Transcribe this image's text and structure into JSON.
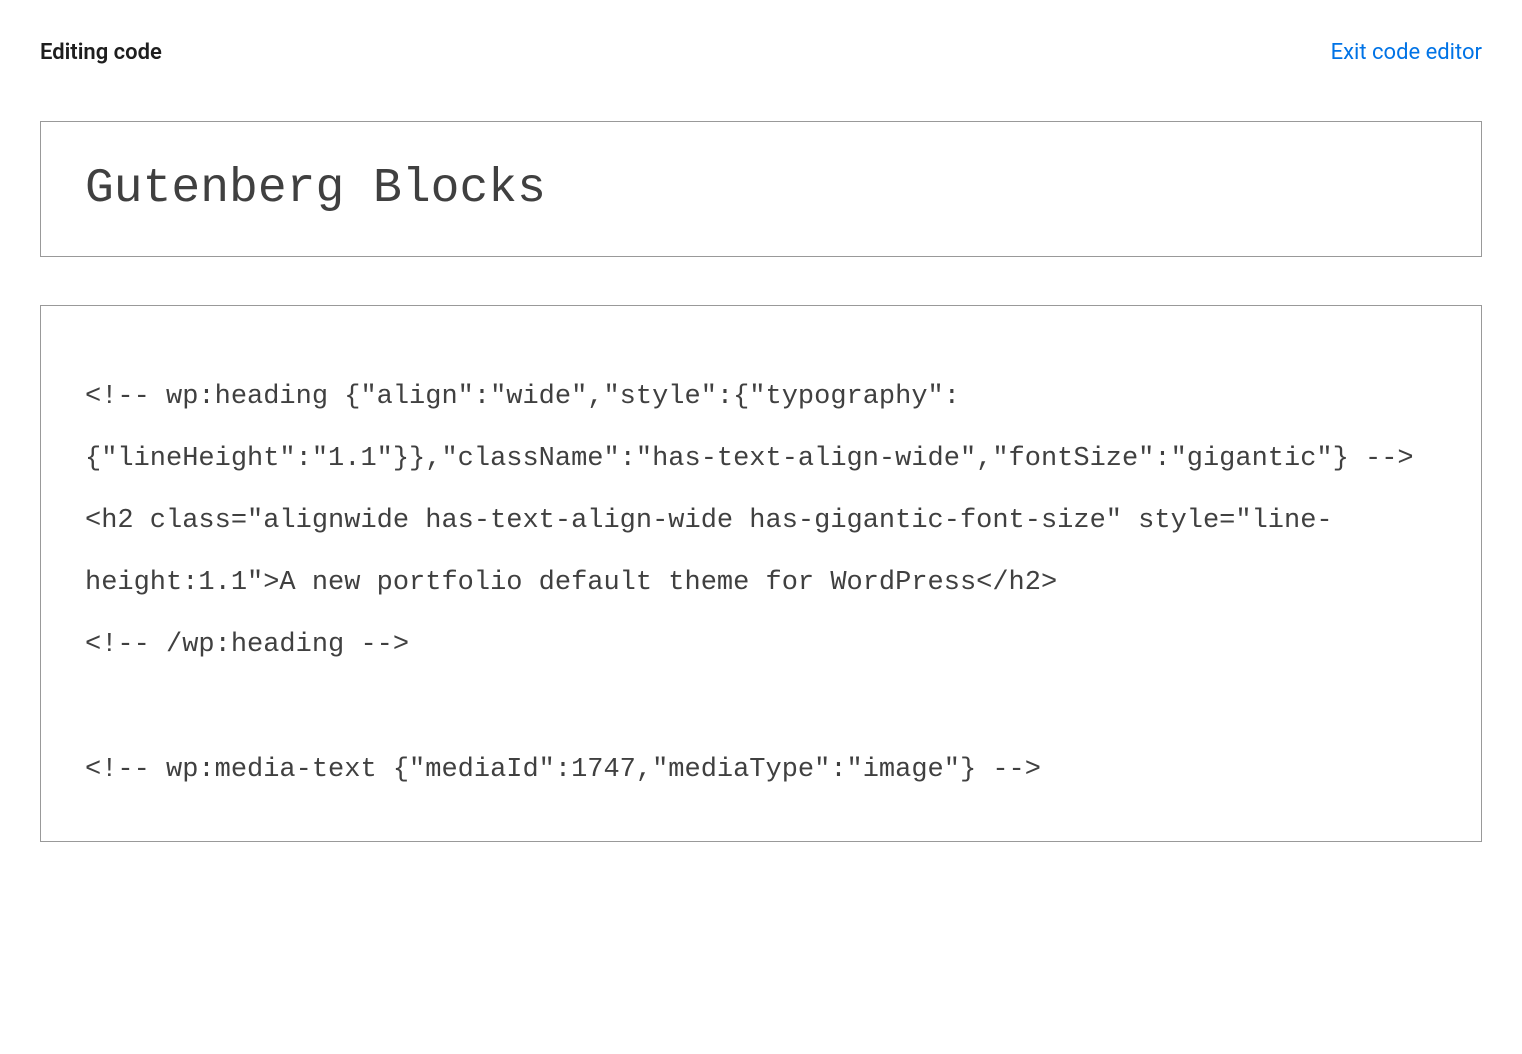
{
  "header": {
    "label": "Editing code",
    "exit_label": "Exit code editor"
  },
  "editor": {
    "title": "Gutenberg Blocks",
    "code": "<!-- wp:heading {\"align\":\"wide\",\"style\":{\"typography\":{\"lineHeight\":\"1.1\"}},\"className\":\"has-text-align-wide\",\"fontSize\":\"gigantic\"} -->\n<h2 class=\"alignwide has-text-align-wide has-gigantic-font-size\" style=\"line-height:1.1\">A new portfolio default theme for WordPress</h2>\n<!-- /wp:heading -->\n\n<!-- wp:media-text {\"mediaId\":1747,\"mediaType\":\"image\"} -->"
  }
}
